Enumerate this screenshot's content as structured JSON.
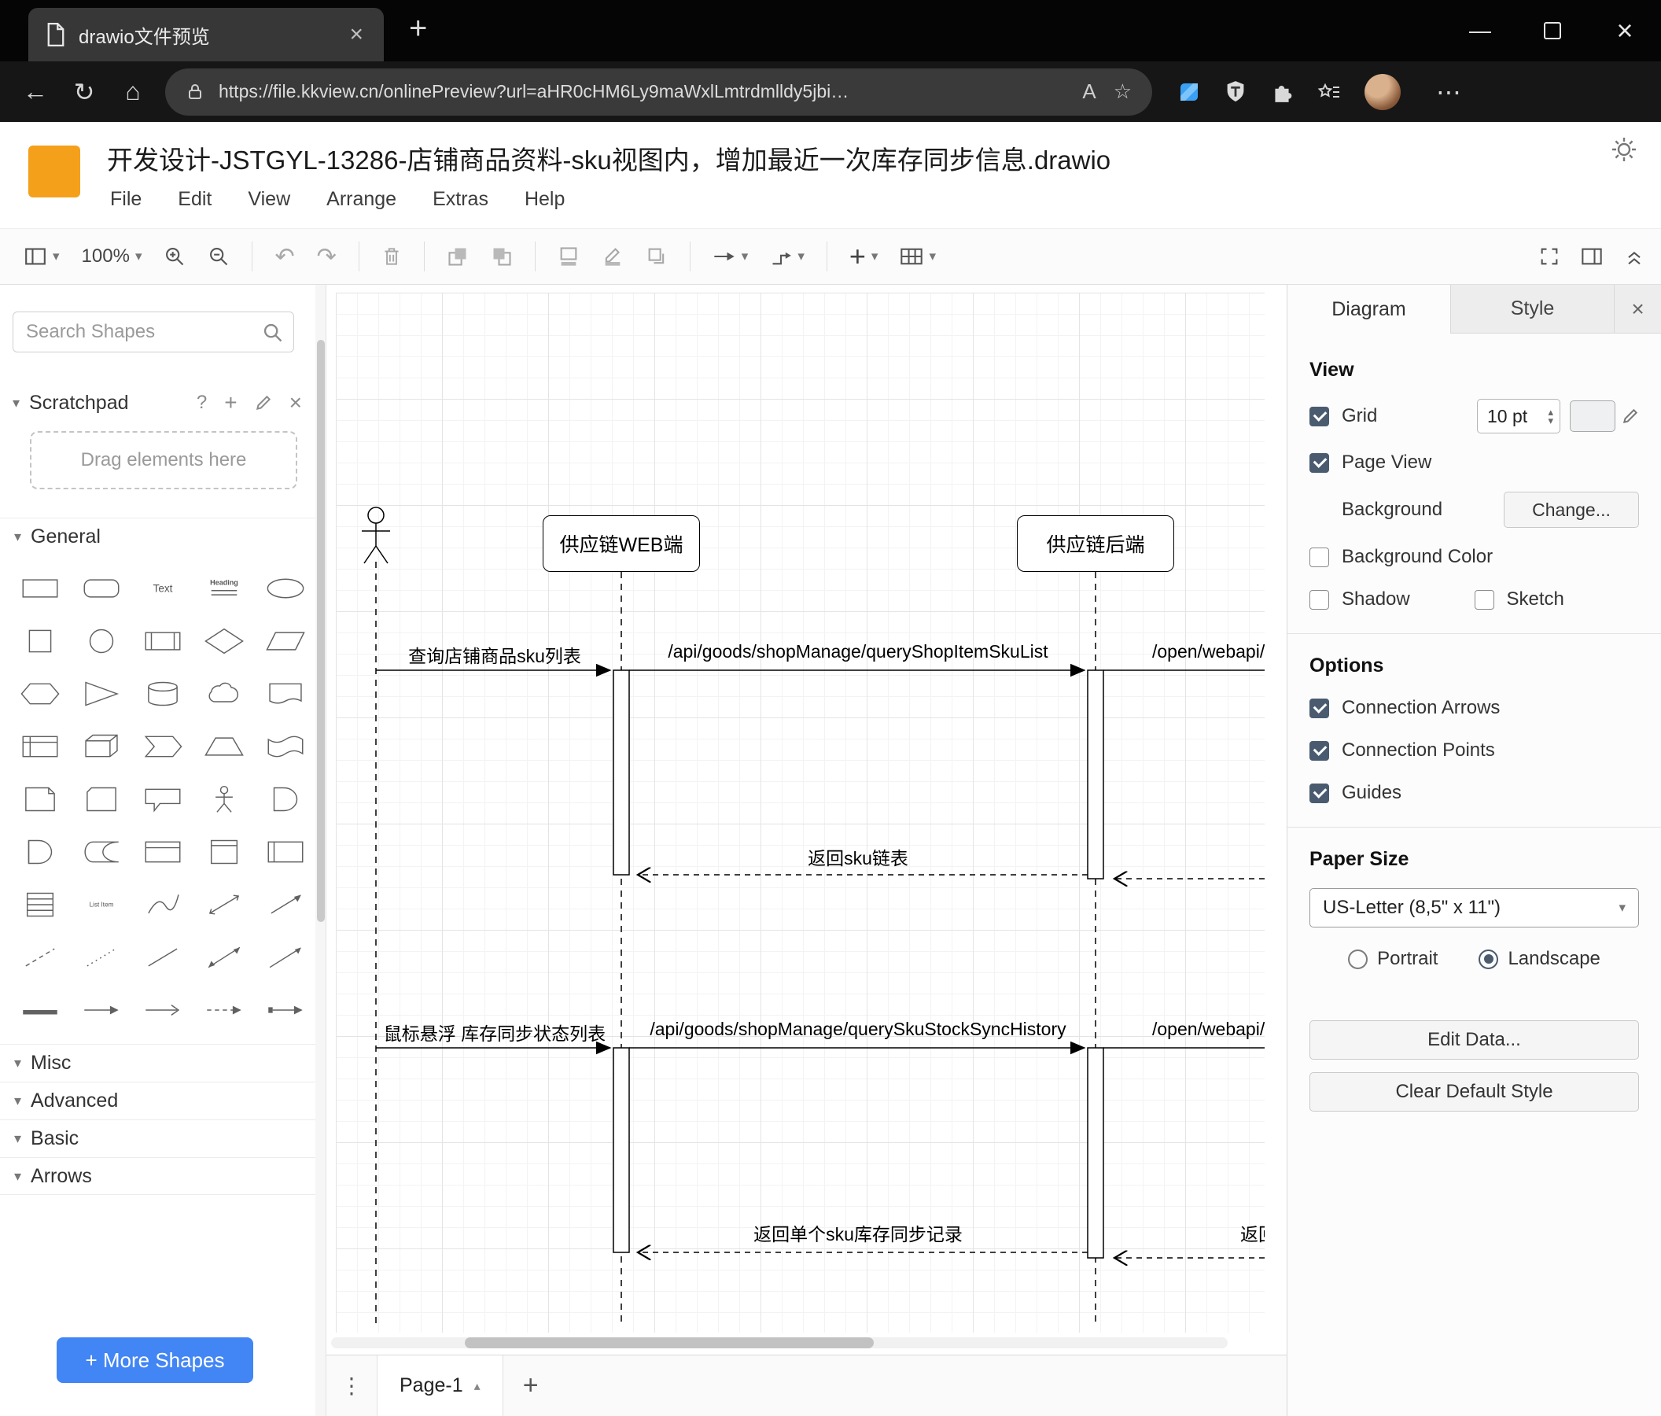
{
  "browser": {
    "tab_title": "drawio文件预览",
    "url": "https://file.kkview.cn/onlinePreview?url=aHR0cHM6Ly9maWxlLmtrdmlldy5jbi…"
  },
  "icons": {
    "back": "←",
    "refresh": "↻",
    "home": "⌂",
    "read_aloud": "A",
    "star": "☆",
    "ellipsis": "⋯",
    "plus": "+",
    "close": "×",
    "minimize": "—",
    "kebab": "⋮",
    "caret_down": "▾",
    "question": "?",
    "undo": "↶",
    "redo": "↷",
    "up_triangle": "▴"
  },
  "app": {
    "title": "开发设计-JSTGYL-13286-店铺商品资料-sku视图内，增加最近一次库存同步信息.drawio",
    "menus": [
      "File",
      "Edit",
      "View",
      "Arrange",
      "Extras",
      "Help"
    ],
    "zoom": "100%"
  },
  "sidebar": {
    "search_placeholder": "Search Shapes",
    "scratchpad_title": "Scratchpad",
    "drop_hint": "Drag elements here",
    "sections": [
      "General",
      "Misc",
      "Advanced",
      "Basic",
      "Arrows"
    ],
    "more_shapes": "+ More Shapes",
    "shape_texts": {
      "text": "Text",
      "heading": "Heading",
      "list_item": "List Item"
    },
    "shapes": [
      "rectangle",
      "rounded-rectangle",
      "text",
      "heading",
      "ellipse",
      "square",
      "circle",
      "process",
      "diamond",
      "parallelogram",
      "hexagon",
      "triangle",
      "cylinder",
      "cloud",
      "document",
      "internal-storage",
      "cube",
      "step",
      "trapezoid",
      "tape",
      "note",
      "card",
      "callout",
      "actor",
      "or",
      "and",
      "data-storage",
      "container",
      "vertical-container",
      "horizontal-container",
      "list",
      "list-item",
      "curve",
      "bidirectional-arrow",
      "arrow",
      "dashed-line",
      "dotted-line",
      "line",
      "bidirectional-connector",
      "directional-connector",
      "link",
      "arrow-right",
      "arrow-right-open",
      "arrow-right-dashed",
      "arrow-right-filled"
    ]
  },
  "canvas": {
    "participants": [
      {
        "label": "供应链WEB端"
      },
      {
        "label": "供应链后端"
      }
    ],
    "messages": {
      "m1a": "查询店铺商品sku列表",
      "m1b": "/api/goods/shopManage/queryShopItemSkuList",
      "m1c": "/open/webapi/",
      "r1": "返回sku链表",
      "m2a": "鼠标悬浮 库存同步状态列表",
      "m2b": "/api/goods/shopManage/querySkuStockSyncHistory",
      "m2c": "/open/webapi/item",
      "r2": "返回单个sku库存同步记录",
      "r3": "返回"
    },
    "page_tab": "Page-1"
  },
  "format": {
    "tabs": {
      "diagram": "Diagram",
      "style": "Style"
    },
    "view": {
      "title": "View",
      "grid": "Grid",
      "grid_checked": true,
      "grid_size": "10 pt",
      "page_view": "Page View",
      "page_view_checked": true,
      "background": "Background",
      "change": "Change...",
      "background_color": "Background Color",
      "background_color_checked": false,
      "shadow": "Shadow",
      "shadow_checked": false,
      "sketch": "Sketch",
      "sketch_checked": false
    },
    "options": {
      "title": "Options",
      "connection_arrows": "Connection Arrows",
      "connection_arrows_checked": true,
      "connection_points": "Connection Points",
      "connection_points_checked": true,
      "guides": "Guides",
      "guides_checked": true
    },
    "paper": {
      "title": "Paper Size",
      "size": "US-Letter (8,5\" x 11\")",
      "portrait": "Portrait",
      "portrait_selected": false,
      "landscape": "Landscape",
      "landscape_selected": true
    },
    "buttons": {
      "edit_data": "Edit Data...",
      "clear_default_style": "Clear Default Style"
    }
  },
  "colors": {
    "logo_orange": "#F5A01B",
    "more_shapes_blue": "#4285f4",
    "check_accent": "#4a5b70",
    "grid_swatch": "#eef0f1"
  }
}
